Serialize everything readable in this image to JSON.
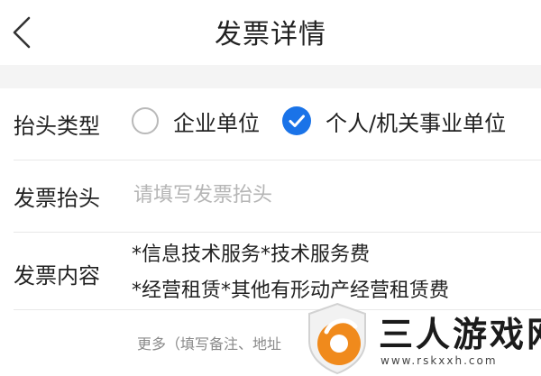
{
  "header": {
    "title": "发票详情",
    "back_icon": "chevron-left-icon"
  },
  "form": {
    "header_type": {
      "label": "抬头类型",
      "options": [
        {
          "label": "企业单位",
          "selected": false
        },
        {
          "label": "个人/机关事业单位",
          "selected": true
        }
      ]
    },
    "invoice_title": {
      "label": "发票抬头",
      "placeholder": "请填写发票抬头",
      "value": ""
    },
    "invoice_content": {
      "label": "发票内容",
      "lines": [
        "*信息技术服务*技术服务费",
        "*经营租赁*其他有形动产经营租赁费"
      ]
    },
    "more": {
      "text": "更多（填写备注、地址"
    }
  },
  "watermark": {
    "name": "三人游戏网",
    "url": "www.rskxxh.com"
  },
  "colors": {
    "accent": "#1a73e8",
    "logo_orange": "#f08a1c"
  }
}
